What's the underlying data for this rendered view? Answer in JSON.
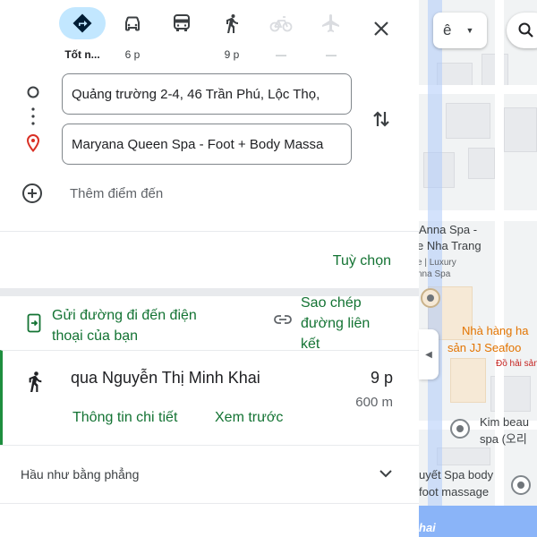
{
  "travel_modes": [
    {
      "name": "best",
      "label": "Tốt n...",
      "icon": "directions-diamond-icon",
      "active": true
    },
    {
      "name": "driving",
      "label": "6 p",
      "icon": "car-icon",
      "active": false
    },
    {
      "name": "transit",
      "label": "",
      "icon": "bus-icon",
      "active": false
    },
    {
      "name": "walking",
      "label": "9 p",
      "icon": "walk-icon",
      "active": false
    },
    {
      "name": "cycling",
      "label": "—",
      "icon": "bicycle-icon",
      "active": false,
      "disabled": true
    },
    {
      "name": "flights",
      "label": "—",
      "icon": "airplane-icon",
      "active": false,
      "disabled": true
    }
  ],
  "route": {
    "origin_value": "Quảng trường 2-4, 46 Trần Phú, Lộc Thọ,",
    "destination_value": "Maryana Queen Spa - Foot + Body Massa",
    "add_destination": "Thêm điểm đến"
  },
  "options_label": "Tuỳ chọn",
  "share": {
    "send_to_phone": "Gửi đường đi đến điện thoại của bạn",
    "copy_link": "Sao chép đường liên kết"
  },
  "route_card": {
    "via": "qua Nguyễn Thị Minh Khai",
    "time": "9 p",
    "distance": "600 m",
    "details_link": "Thông tin chi tiết",
    "preview_link": "Xem trước"
  },
  "terrain_label": "Hầu như bằng phẳng",
  "map": {
    "labels": {
      "anna_spa": "Anna Spa -",
      "nha_trang": "e Nha Trang",
      "luxury": "e | Luxury",
      "anna_spa2": "nna Spa",
      "restaurant1": "Nhà hàng ha",
      "restaurant2": "sản JJ Seafoo",
      "seafood_cat": "Đồ hải sản",
      "beauty1": "Kim beau",
      "beauty2": "spa (오리",
      "spa1": "uyết Spa body",
      "spa2": "foot massage",
      "street": "hai"
    },
    "layer_label": "ê"
  },
  "colors": {
    "active_mode_bg": "#c2e7ff",
    "link_green": "#137333",
    "destination_red": "#d93025"
  }
}
